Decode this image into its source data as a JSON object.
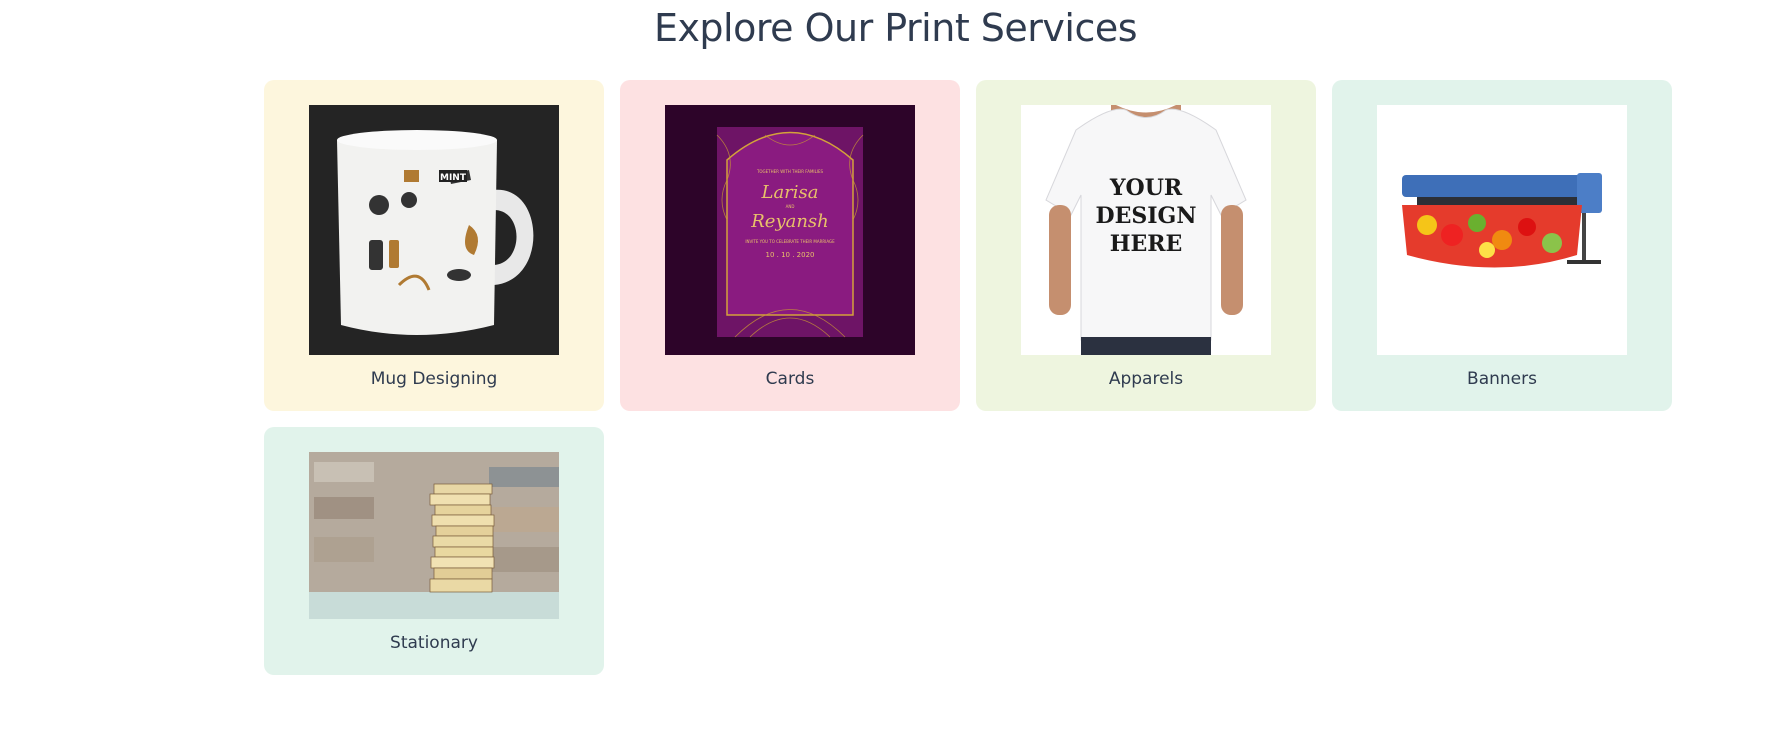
{
  "page": {
    "title": "Explore Our Print Services"
  },
  "services": [
    {
      "label": "Mug Designing",
      "bg": "#fdf6dd",
      "image_icon": "mug-photo"
    },
    {
      "label": "Cards",
      "bg": "#fde1e2",
      "image_icon": "wedding-invitation-card-photo",
      "card_text": {
        "line1": "TOGETHER WITH THEIR FAMILIES",
        "name1": "Larisa",
        "and": "AND",
        "name2": "Reyansh",
        "invite": "INVITE YOU TO CELEBRATE THEIR MARRIAGE",
        "date": "10 . 10 . 2020"
      }
    },
    {
      "label": "Apparels",
      "bg": "#eef5df",
      "image_icon": "tshirt-photo",
      "shirt_text": [
        "YOUR",
        "DESIGN",
        "HERE"
      ]
    },
    {
      "label": "Banners",
      "bg": "#e1f3eb",
      "image_icon": "banner-printer-photo"
    },
    {
      "label": "Stationary",
      "bg": "#e1f3eb",
      "image_icon": "books-stack-photo"
    }
  ]
}
